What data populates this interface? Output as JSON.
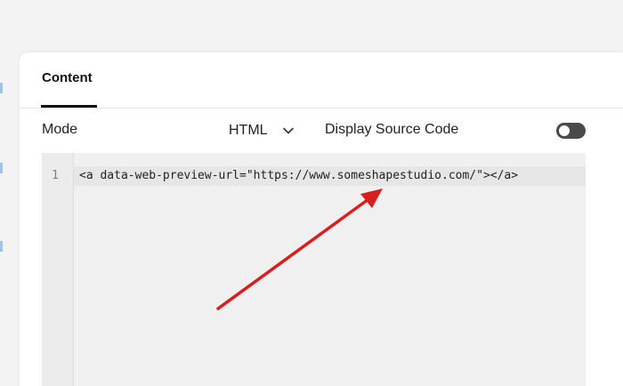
{
  "panel": {
    "tabs": [
      {
        "label": "Content"
      }
    ]
  },
  "mode_row": {
    "mode_label": "Mode",
    "mode_value": "HTML",
    "display_source_label": "Display Source Code",
    "display_source_on": false
  },
  "editor": {
    "lines": [
      {
        "number": "1",
        "code": "<a data-web-preview-url=\"https://www.someshapestudio.com/\"></a>"
      }
    ]
  },
  "colors": {
    "annotation_arrow": "#d81e1e",
    "toggle_track": "#4a4a4a"
  },
  "icons": {
    "mode_dropdown": "chevron-down-icon"
  }
}
